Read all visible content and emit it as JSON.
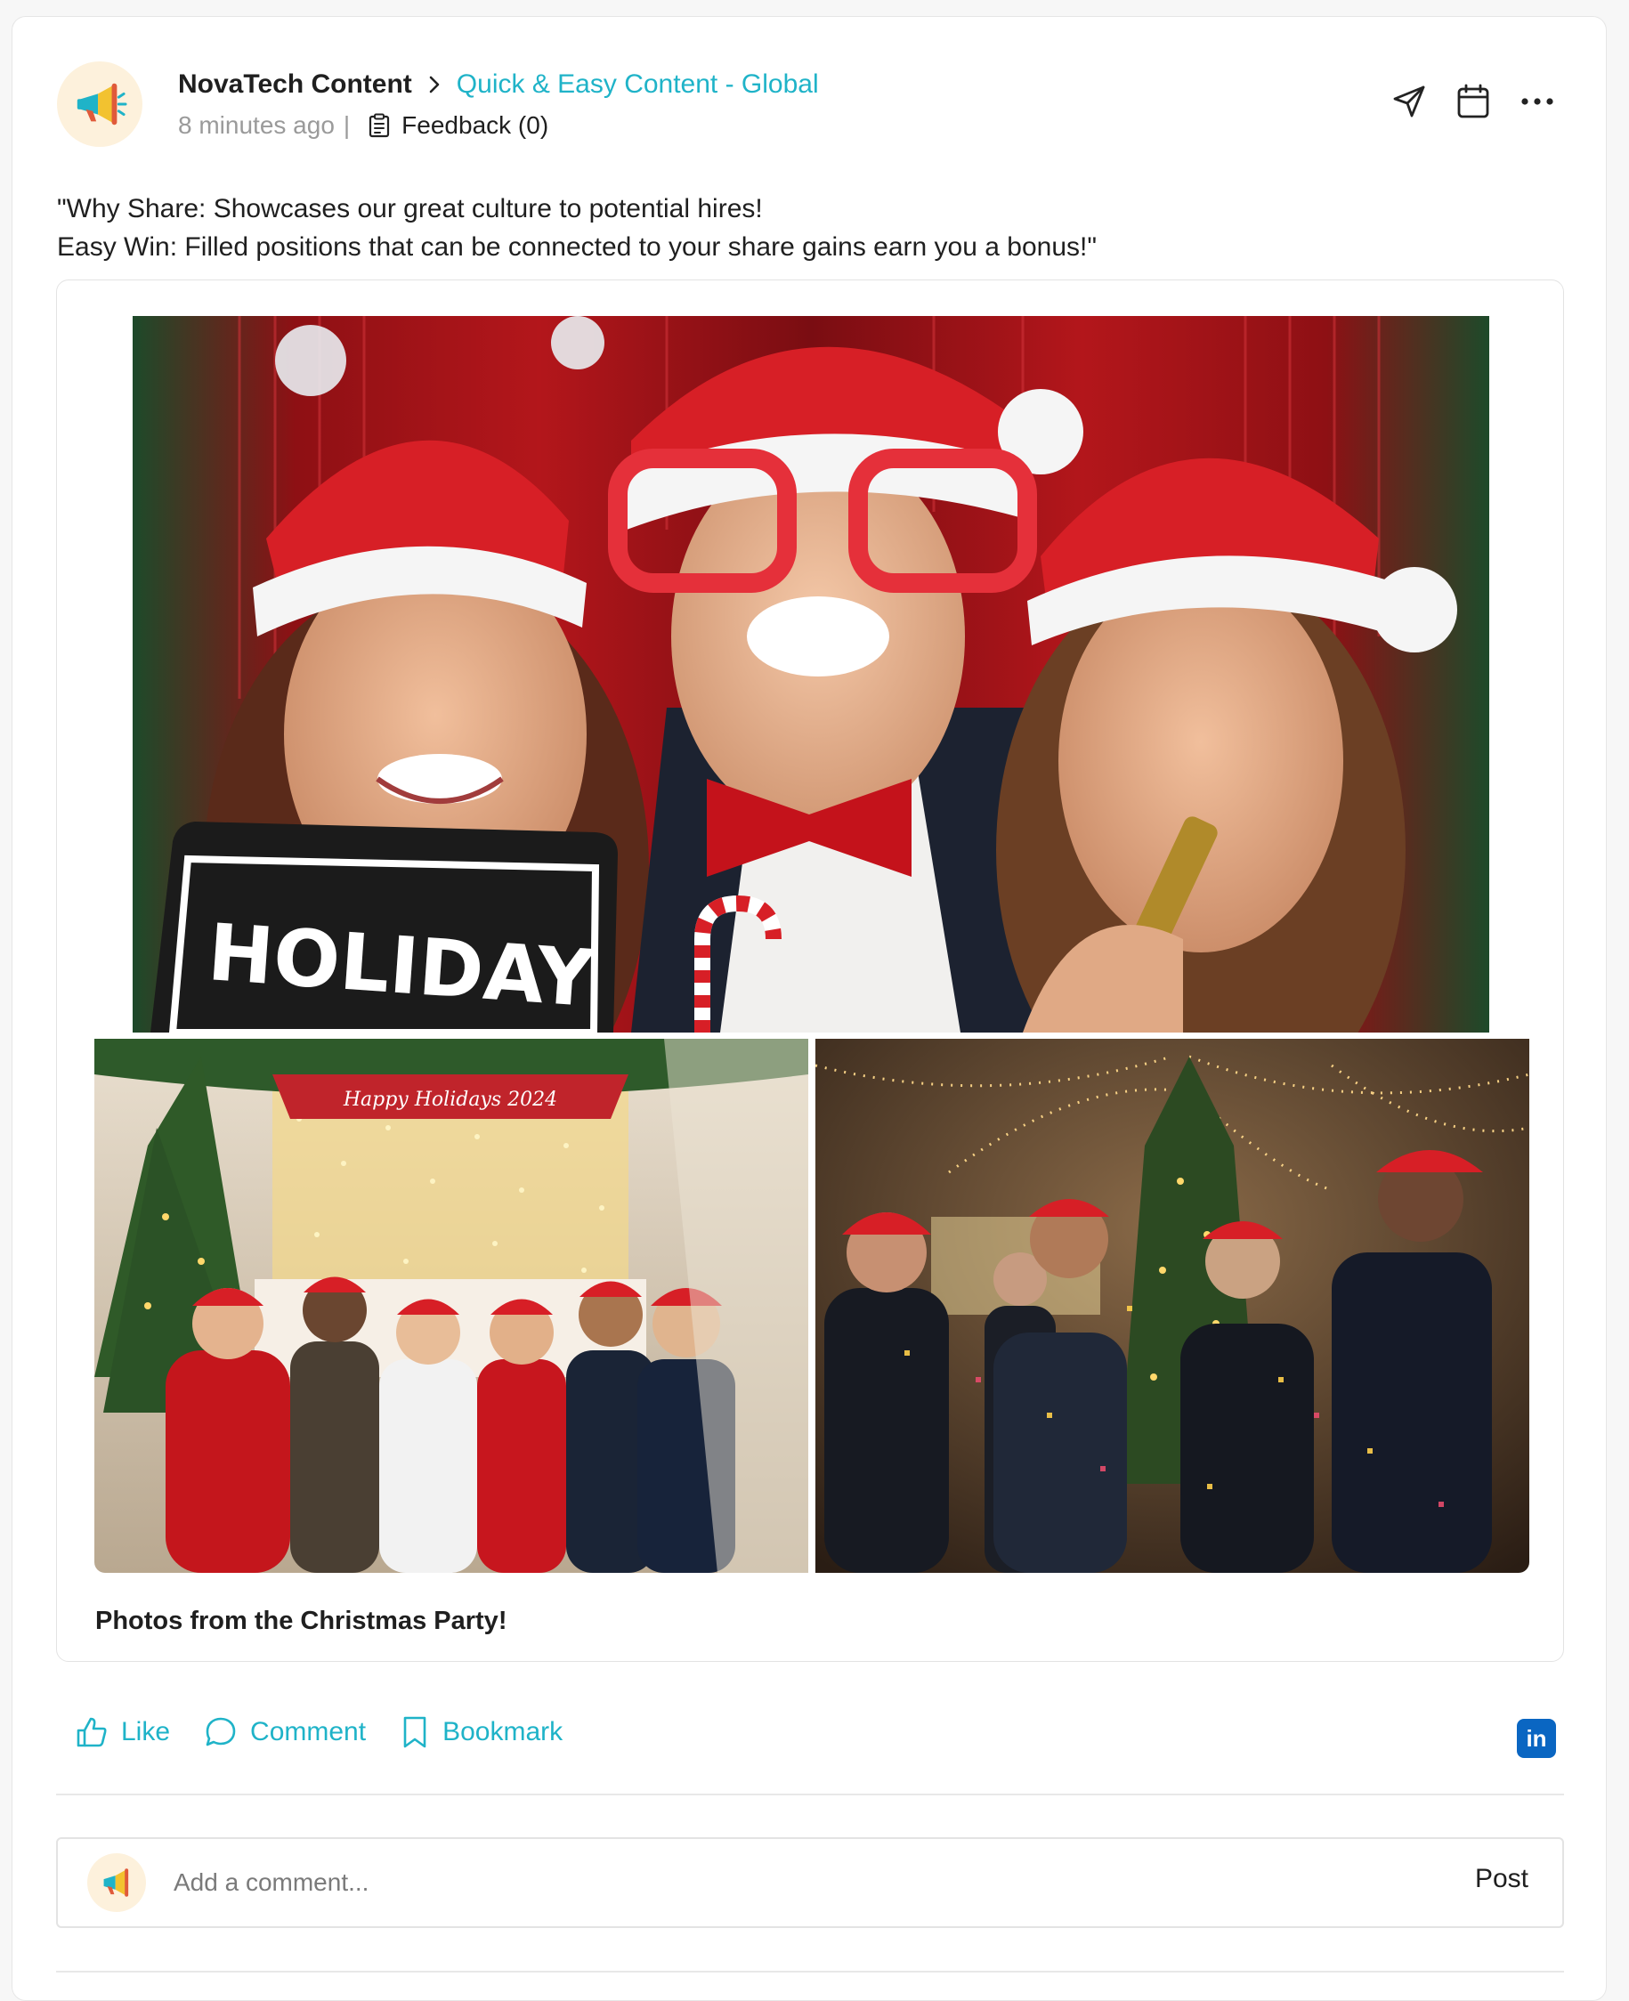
{
  "post": {
    "author": "NovaTech Content",
    "channel": "Quick & Easy Content - Global",
    "time": "8 minutes ago",
    "separator": "|",
    "feedback": "Feedback (0)",
    "text_line1": "\"Why Share: Showcases our great culture to potential hires!",
    "text_line2": "Easy Win: Filled positions that can be connected to your share gains earn you a bonus!\"",
    "image_sign_text": "HOLIDAY",
    "image_banner_text": "Happy Holidays 2024",
    "caption": "Photos from the Christmas Party!"
  },
  "actions": {
    "like": "Like",
    "comment": "Comment",
    "bookmark": "Bookmark",
    "linkedin": "in"
  },
  "comment": {
    "placeholder": "Add a comment...",
    "post_label": "Post"
  },
  "colors": {
    "accent": "#1fb3c8",
    "linkedin": "#0a66c2",
    "avatar_bg": "#fdf1dc"
  }
}
